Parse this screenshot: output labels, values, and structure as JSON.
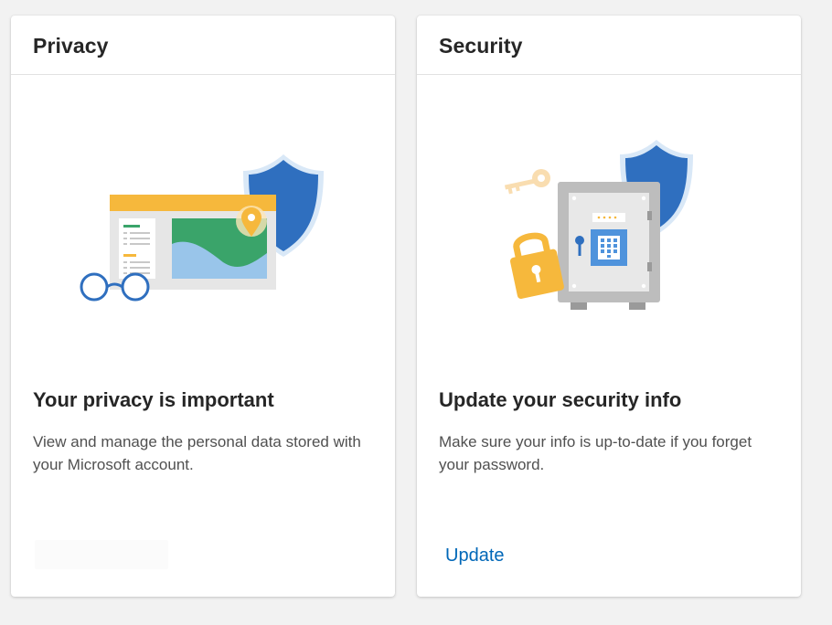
{
  "colors": {
    "shield_blue": "#2f6fbf",
    "accent_yellow": "#f6b83c",
    "map_green": "#3aa46a",
    "map_light_blue": "#99c5ea",
    "link_blue": "#0067b8",
    "safe_gray": "#bdbdbd"
  },
  "privacy": {
    "title": "Privacy",
    "heading": "Your privacy is important",
    "description": "View and manage the personal data stored with your Microsoft account.",
    "illustration_icons": [
      "browser-window-icon",
      "map-pin-icon",
      "shield-icon",
      "glasses-icon"
    ]
  },
  "security": {
    "title": "Security",
    "heading": "Update your security info",
    "description": "Make sure your info is up-to-date if you forget your password.",
    "action_label": "Update",
    "illustration_icons": [
      "safe-icon",
      "keypad-icon",
      "key-icon",
      "padlock-icon",
      "shield-icon"
    ]
  }
}
